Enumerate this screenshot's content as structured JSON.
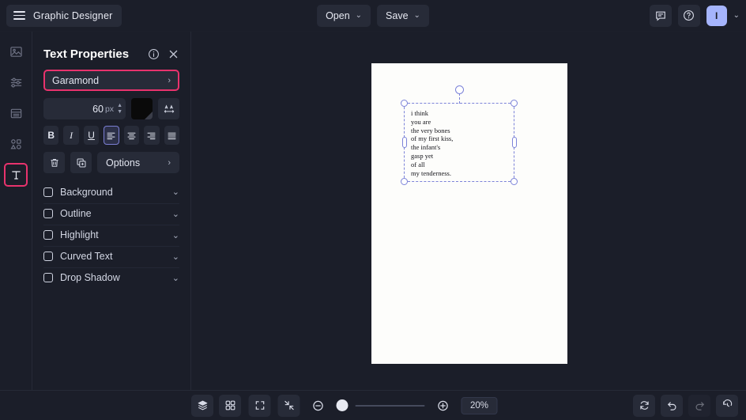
{
  "app": {
    "title": "Graphic Designer",
    "menu_icon": "hamburger-icon"
  },
  "header": {
    "open_label": "Open",
    "save_label": "Save",
    "comment_icon": "comment-icon",
    "help_icon": "help-circle-icon",
    "avatar_initial": "I",
    "avatar_color": "#a5b4fc",
    "avatar_chevron": "⌄",
    "open_chevron": "⌄",
    "save_chevron": "⌄"
  },
  "rail": {
    "tools": [
      {
        "name": "image-tool",
        "icon": "image-icon",
        "active": false
      },
      {
        "name": "adjustments-tool",
        "icon": "sliders-icon",
        "active": false
      },
      {
        "name": "layout-tool",
        "icon": "layout-icon",
        "active": false
      },
      {
        "name": "shapes-tool",
        "icon": "shapes-icon",
        "active": false
      },
      {
        "name": "text-tool",
        "icon": "text-icon",
        "active": true
      }
    ],
    "active_outline_color": "#e8336d"
  },
  "panel": {
    "title": "Text Properties",
    "info_icon": "info-icon",
    "close_icon": "close-icon",
    "font": {
      "value": "Garamond",
      "chevron": "›",
      "highlight_color": "#e8336d"
    },
    "size": {
      "value": "60",
      "unit": "px",
      "up": "▲",
      "down": "▼"
    },
    "color_swatch": "#0a0a0a",
    "letter_spacing_icon": "letter-spacing-icon",
    "format_buttons": [
      {
        "label": "B",
        "name": "bold-button",
        "selected": false
      },
      {
        "label": "I",
        "name": "italic-button",
        "selected": false
      },
      {
        "label": "U",
        "name": "underline-button",
        "selected": false
      }
    ],
    "alignment": [
      {
        "name": "align-left-button",
        "selected": true
      },
      {
        "name": "align-center-button",
        "selected": false
      },
      {
        "name": "align-right-button",
        "selected": false
      },
      {
        "name": "align-justify-button",
        "selected": false
      }
    ],
    "delete_icon": "trash-icon",
    "duplicate_icon": "duplicate-icon",
    "options_label": "Options",
    "options_chevron": "›",
    "checkboxes": [
      {
        "label": "Background",
        "checked": false,
        "chevron": "⌄"
      },
      {
        "label": "Outline",
        "checked": false,
        "chevron": "⌄"
      },
      {
        "label": "Highlight",
        "checked": false,
        "chevron": "⌄"
      },
      {
        "label": "Curved Text",
        "checked": false,
        "chevron": "⌄"
      },
      {
        "label": "Drop Shadow",
        "checked": false,
        "chevron": "⌄"
      }
    ]
  },
  "canvas": {
    "artboard_color": "#fdfdfb",
    "selection_color": "#7b82d8",
    "text": "i think\nyou are\nthe very bones\nof my first kiss,\nthe infant's\ngasp yet\nof all\nmy tenderness."
  },
  "bottombar": {
    "layers_icon": "layers-icon",
    "grid_icon": "grid-icon",
    "fit_icon": "fit-screen-icon",
    "shrink_icon": "shrink-icon",
    "zoom_out_icon": "zoom-out-icon",
    "zoom_in_icon": "zoom-in-icon",
    "zoom_value": "20%",
    "sync_icon": "sync-icon",
    "undo_icon": "undo-icon",
    "redo_icon": "redo-icon",
    "history_icon": "history-icon"
  }
}
